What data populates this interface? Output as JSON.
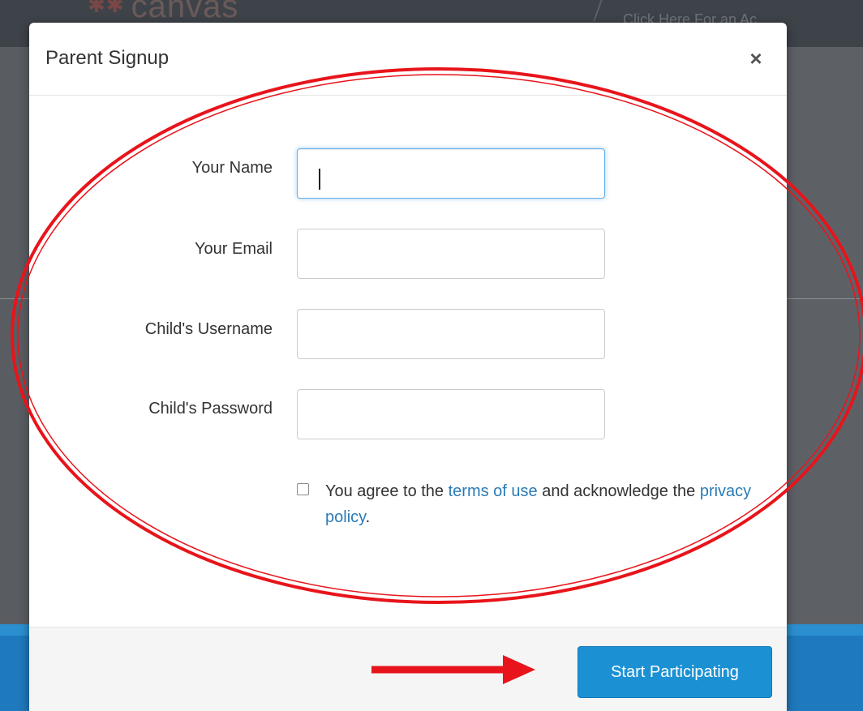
{
  "background": {
    "logo_text": "canvas",
    "promo_text": "Click Here For an Ac"
  },
  "modal": {
    "title": "Parent Signup",
    "close_glyph": "×",
    "fields": [
      {
        "label": "Your Name",
        "value": "",
        "placeholder": ""
      },
      {
        "label": "Your Email",
        "value": "",
        "placeholder": ""
      },
      {
        "label": "Child's Username",
        "value": "",
        "placeholder": ""
      },
      {
        "label": "Child's Password",
        "value": "",
        "placeholder": ""
      }
    ],
    "agreement": {
      "checked": false,
      "prefix": "You agree to the ",
      "terms_link": "terms of use",
      "middle": " and acknowledge the ",
      "privacy_link": "privacy policy",
      "suffix": "."
    },
    "submit_label": "Start Participating"
  },
  "annotations": {
    "highlight_color": "#e8141b",
    "shapes": [
      "ellipse-highlight",
      "arrow-pointer"
    ]
  },
  "colors": {
    "link": "#2a7bb5",
    "primary_button": "#1b91d4",
    "focus_border": "#66afe9"
  }
}
